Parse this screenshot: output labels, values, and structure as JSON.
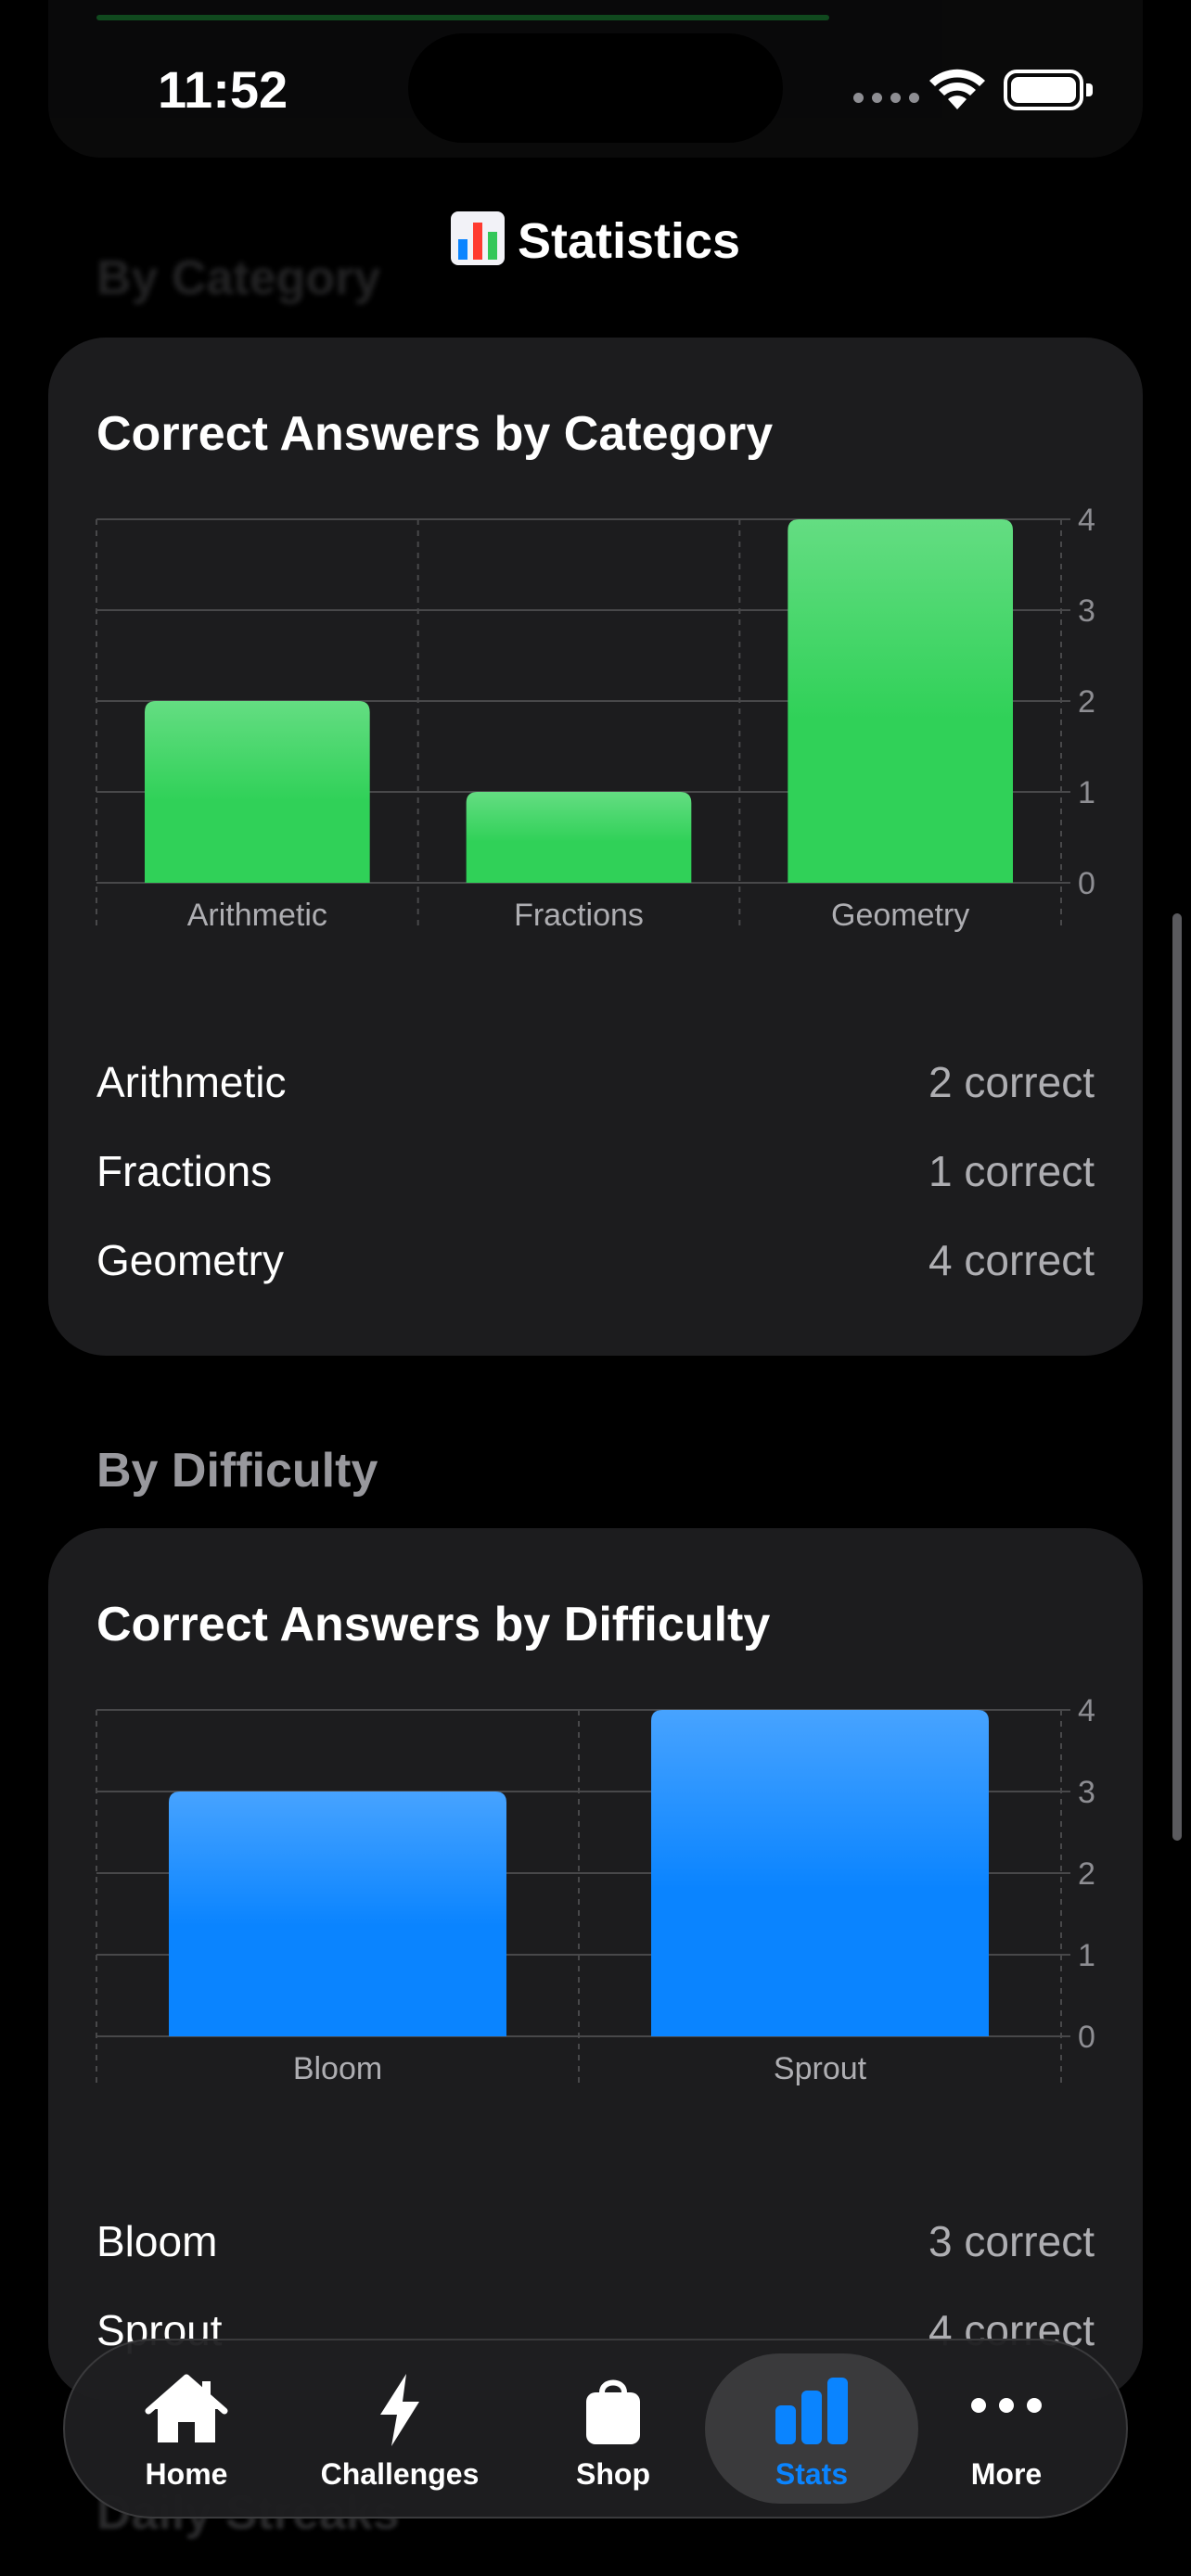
{
  "status_bar": {
    "time": "11:52"
  },
  "nav": {
    "title": "Statistics",
    "icon": "bar-chart-emoji"
  },
  "sections": {
    "category_header": "By Category",
    "difficulty_header": "By Difficulty",
    "next_header": "Daily Streaks"
  },
  "category_card": {
    "title": "Correct Answers by Category",
    "rows": [
      {
        "label": "Arithmetic",
        "value": "2 correct"
      },
      {
        "label": "Fractions",
        "value": "1 correct"
      },
      {
        "label": "Geometry",
        "value": "4 correct"
      }
    ]
  },
  "difficulty_card": {
    "title": "Correct Answers by Difficulty",
    "rows": [
      {
        "label": "Bloom",
        "value": "3 correct"
      },
      {
        "label": "Sprout",
        "value": "4 correct"
      }
    ]
  },
  "chart_data": [
    {
      "type": "bar",
      "title": "Correct Answers by Category",
      "categories": [
        "Arithmetic",
        "Fractions",
        "Geometry"
      ],
      "values": [
        2,
        1,
        4
      ],
      "ylim": [
        0,
        4
      ],
      "yticks": [
        0,
        1,
        2,
        3,
        4
      ],
      "color": "#30d158",
      "grid": true,
      "y_axis_side": "right"
    },
    {
      "type": "bar",
      "title": "Correct Answers by Difficulty",
      "categories": [
        "Bloom",
        "Sprout"
      ],
      "values": [
        3,
        4
      ],
      "ylim": [
        0,
        4
      ],
      "yticks": [
        0,
        1,
        2,
        3,
        4
      ],
      "color": "#0a84ff",
      "grid": true,
      "y_axis_side": "right"
    }
  ],
  "tab_bar": {
    "tabs": [
      {
        "label": "Home",
        "icon": "house-icon",
        "active": false
      },
      {
        "label": "Challenges",
        "icon": "bolt-icon",
        "active": false
      },
      {
        "label": "Shop",
        "icon": "bag-icon",
        "active": false
      },
      {
        "label": "Stats",
        "icon": "chart-bar-icon",
        "active": true
      },
      {
        "label": "More",
        "icon": "ellipsis-icon",
        "active": false
      }
    ]
  },
  "colors": {
    "accent": "#0a84ff",
    "green": "#30d158",
    "card_bg": "#1c1c1e",
    "background": "#000000"
  }
}
